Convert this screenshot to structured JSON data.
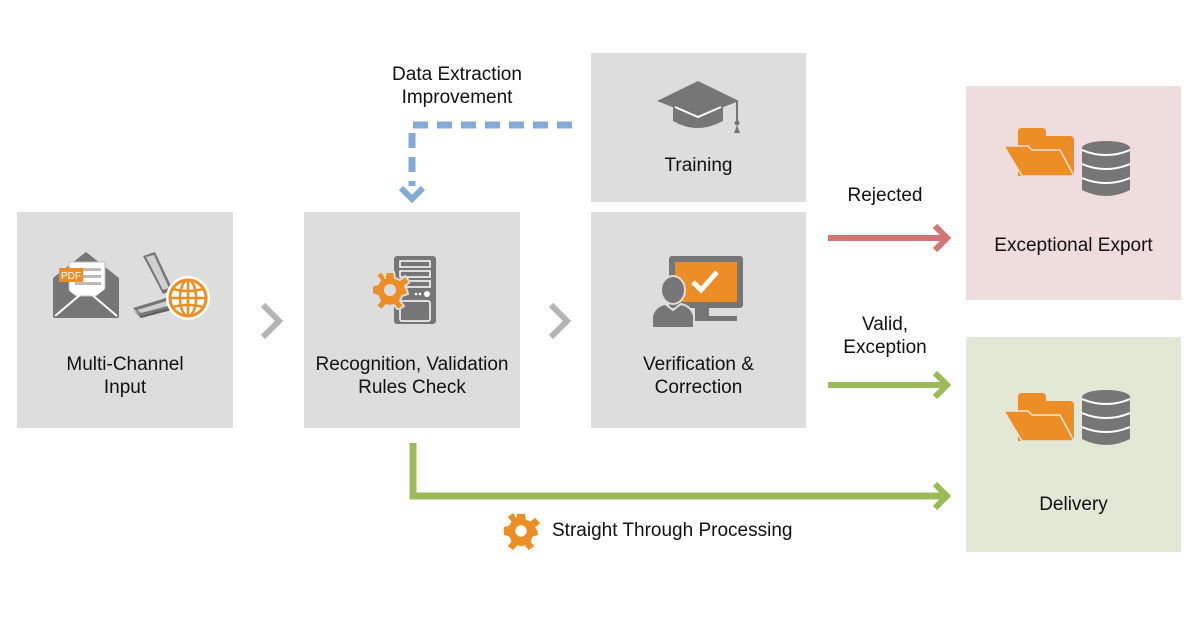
{
  "diagram": {
    "stages": {
      "input": {
        "label_line1": "Multi-Channel",
        "label_line2": "Input",
        "icons": [
          "envelope-pdf-icon",
          "scanner-icon",
          "globe-icon"
        ]
      },
      "recognition": {
        "label_line1": "Recognition, Validation",
        "label_line2": "Rules Check",
        "icons": [
          "gear-icon",
          "server-icon"
        ]
      },
      "verification": {
        "label_line1": "Verification &",
        "label_line2": "Correction",
        "icons": [
          "user-icon",
          "monitor-check-icon"
        ]
      },
      "training": {
        "label": "Training",
        "icons": [
          "graduation-cap-icon"
        ]
      },
      "export": {
        "label": "Exceptional Export",
        "icons": [
          "folder-icon",
          "database-icon"
        ]
      },
      "delivery": {
        "label": "Delivery",
        "icons": [
          "folder-icon",
          "database-icon"
        ]
      }
    },
    "flows": {
      "improvement": {
        "label_line1": "Data Extraction",
        "label_line2": "Improvement"
      },
      "rejected": {
        "label": "Rejected"
      },
      "valid": {
        "label_line1": "Valid,",
        "label_line2": "Exception"
      },
      "stp": {
        "label": "Straight Through Processing"
      }
    },
    "pdf_tag": "PDF",
    "colors": {
      "box_gray": "#dddddd",
      "box_export": "#efdcdc",
      "box_delivery": "#e3e7d6",
      "icon_gray": "#767676",
      "accent_orange": "#ec8e25",
      "arrow_green": "#9bbb59",
      "arrow_red": "#d27575",
      "arrow_blue_dashed": "#84abd6",
      "chevron_gray": "#b5b5b5"
    }
  }
}
